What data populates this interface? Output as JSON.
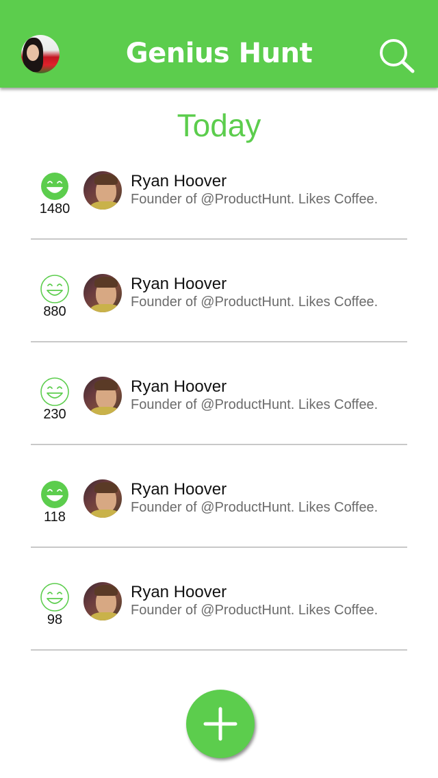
{
  "colors": {
    "accent": "#5ccd4d",
    "divider": "#c8c8c8",
    "text_primary": "#111111",
    "text_secondary": "#6b6b6b"
  },
  "header": {
    "title": "Genius Hunt",
    "avatar_icon": "user-avatar",
    "search_icon": "search-icon"
  },
  "section": {
    "title": "Today"
  },
  "rows": [
    {
      "votes": "1480",
      "voted": true,
      "name": "Ryan Hoover",
      "bio": "Founder of @ProductHunt. Likes Coffee."
    },
    {
      "votes": "880",
      "voted": false,
      "name": "Ryan Hoover",
      "bio": "Founder of @ProductHunt. Likes Coffee."
    },
    {
      "votes": "230",
      "voted": false,
      "name": "Ryan Hoover",
      "bio": "Founder of @ProductHunt. Likes Coffee."
    },
    {
      "votes": "118",
      "voted": true,
      "name": "Ryan Hoover",
      "bio": "Founder of @ProductHunt. Likes Coffee."
    },
    {
      "votes": "98",
      "voted": false,
      "name": "Ryan Hoover",
      "bio": "Founder of @ProductHunt. Likes Coffee."
    }
  ],
  "fab": {
    "icon": "plus-icon"
  }
}
